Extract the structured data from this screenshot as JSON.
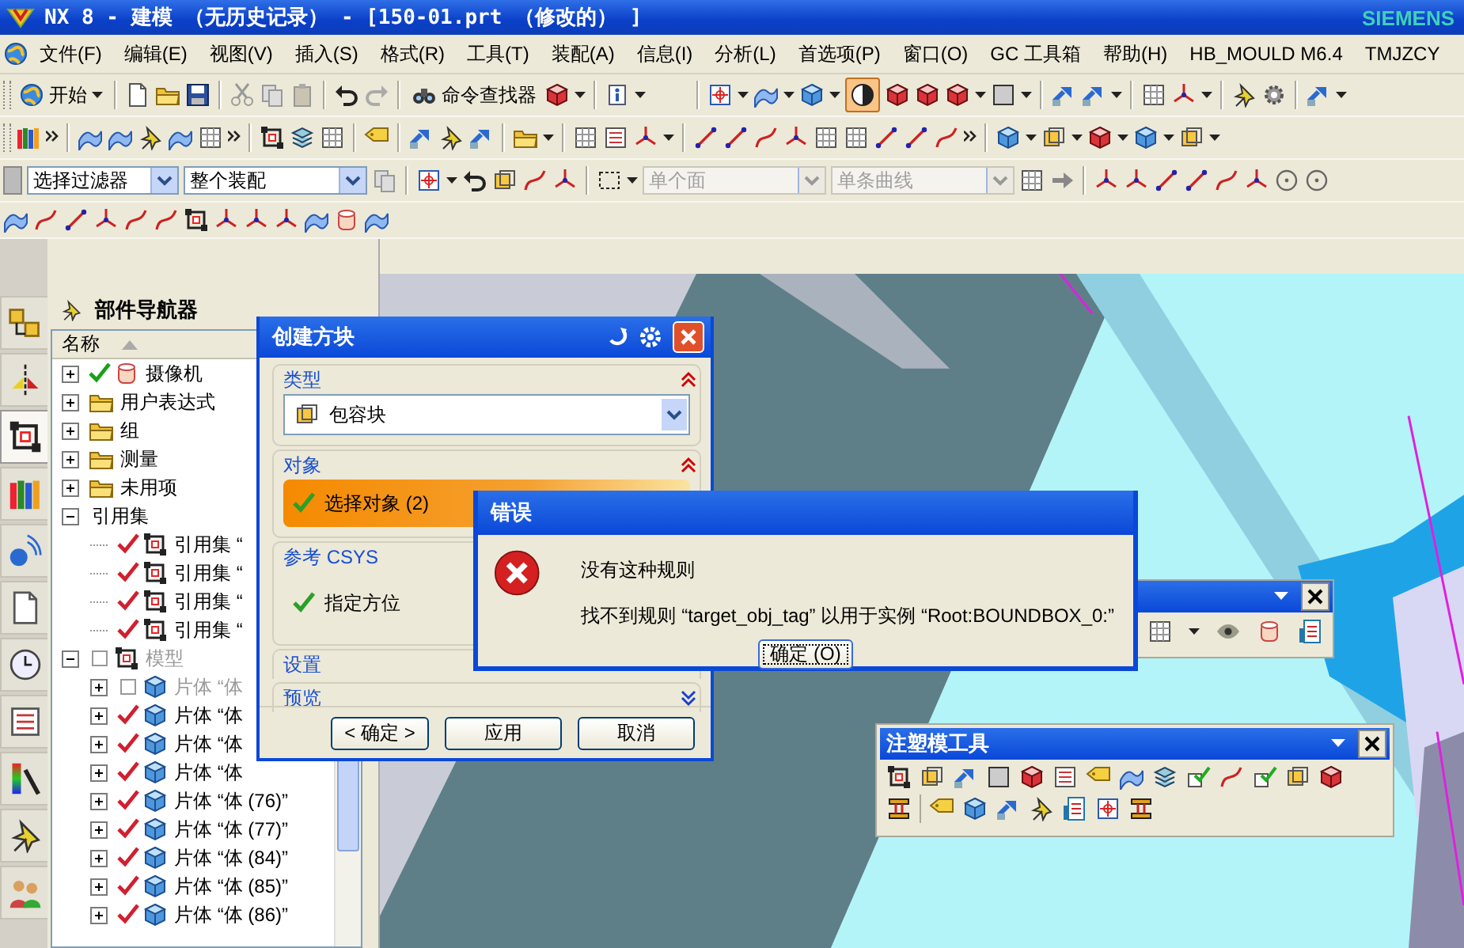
{
  "window": {
    "title": "NX 8 - 建模 （无历史记录） - [150-01.prt （修改的） ]",
    "brand": "SIEMENS"
  },
  "menu": [
    "文件(F)",
    "编辑(E)",
    "视图(V)",
    "插入(S)",
    "格式(R)",
    "工具(T)",
    "装配(A)",
    "信息(I)",
    "分析(L)",
    "首选项(P)",
    "窗口(O)",
    "GC 工具箱",
    "帮助(H)",
    "HB_MOULD M6.4",
    "TMJZCY"
  ],
  "toolbar": {
    "start_button": "开始",
    "command_finder": "命令查找器",
    "selection_filter": {
      "value": "选择过滤器",
      "disabled": false
    },
    "assembly_scope": {
      "value": "整个装配",
      "disabled": false
    },
    "face_rule": {
      "value": "单个面",
      "disabled": true
    },
    "curve_rule": {
      "value": "单条曲线",
      "disabled": true
    }
  },
  "resource_tabs": [
    {
      "selected": false
    },
    {
      "selected": false
    },
    {
      "selected": true
    },
    {
      "selected": false
    },
    {
      "selected": false
    },
    {
      "selected": false
    },
    {
      "selected": false
    },
    {
      "selected": false
    },
    {
      "selected": false
    },
    {
      "selected": false
    },
    {
      "selected": false
    }
  ],
  "navigator": {
    "title": "部件导航器",
    "column": "名称",
    "tree": [
      {
        "kind": "camera",
        "label": "摄像机",
        "checked": true,
        "expanded": false,
        "disabled": false
      },
      {
        "kind": "expressions",
        "label": "用户表达式",
        "expanded": false,
        "disabled": false
      },
      {
        "kind": "folder",
        "label": "组",
        "expanded": false,
        "disabled": false
      },
      {
        "kind": "measure",
        "label": "测量",
        "expanded": false,
        "disabled": false
      },
      {
        "kind": "folder",
        "label": "未用项",
        "expanded": false,
        "disabled": false
      },
      {
        "kind": "group",
        "label": "引用集",
        "expanded": true,
        "disabled": false,
        "children": [
          {
            "kind": "refset",
            "label": "引用集 “",
            "checked": true,
            "disabled": false
          },
          {
            "kind": "refset",
            "label": "引用集 “",
            "checked": true,
            "disabled": false
          },
          {
            "kind": "refset",
            "label": "引用集 “",
            "checked": true,
            "disabled": false
          },
          {
            "kind": "refset",
            "label": "引用集 “",
            "checked": true,
            "disabled": false
          }
        ]
      },
      {
        "kind": "refset",
        "label": "模型",
        "expanded": true,
        "checked": false,
        "disabled": true,
        "children": [
          {
            "kind": "body",
            "label": "片体 “体",
            "expanded": false,
            "checked": false,
            "disabled": true
          },
          {
            "kind": "body",
            "label": "片体 “体",
            "expanded": false,
            "checked": true,
            "disabled": false
          },
          {
            "kind": "body",
            "label": "片体 “体",
            "expanded": false,
            "checked": true,
            "disabled": false
          },
          {
            "kind": "body",
            "label": "片体 “体",
            "expanded": false,
            "checked": true,
            "disabled": false
          },
          {
            "kind": "body",
            "label": "片体 “体 (76)”",
            "expanded": false,
            "checked": true,
            "disabled": false
          },
          {
            "kind": "body",
            "label": "片体 “体 (77)”",
            "expanded": false,
            "checked": true,
            "disabled": false
          },
          {
            "kind": "body",
            "label": "片体 “体 (84)”",
            "expanded": false,
            "checked": true,
            "disabled": false
          },
          {
            "kind": "body",
            "label": "片体 “体 (85)”",
            "expanded": false,
            "checked": true,
            "disabled": false
          },
          {
            "kind": "body",
            "label": "片体 “体 (86)”",
            "expanded": false,
            "checked": true,
            "disabled": false
          }
        ]
      }
    ]
  },
  "block_dialog": {
    "title": "创建方块",
    "sections": [
      {
        "kind": "type",
        "title": "类型",
        "expanded": true,
        "value": "包容块"
      },
      {
        "kind": "objects",
        "title": "对象",
        "expanded": true,
        "label": "选择对象 (2)",
        "selected": true
      },
      {
        "kind": "orientation",
        "title": "参考 CSYS",
        "expanded": true,
        "label": "指定方位"
      },
      {
        "kind": "settings",
        "title": "设置",
        "expanded": false
      },
      {
        "kind": "preview",
        "title": "预览",
        "expanded": false
      }
    ],
    "buttons": [
      "< 确定 >",
      "应用",
      "取消"
    ]
  },
  "error_dialog": {
    "title": "错误",
    "message": "没有这种规则",
    "detail": "找不到规则 “target_obj_tag” 以用于实例 “Root:BOUNDBOX_0:”",
    "button": "确定 (O)"
  },
  "mold_toolbar": {
    "title": "注塑模工具"
  }
}
